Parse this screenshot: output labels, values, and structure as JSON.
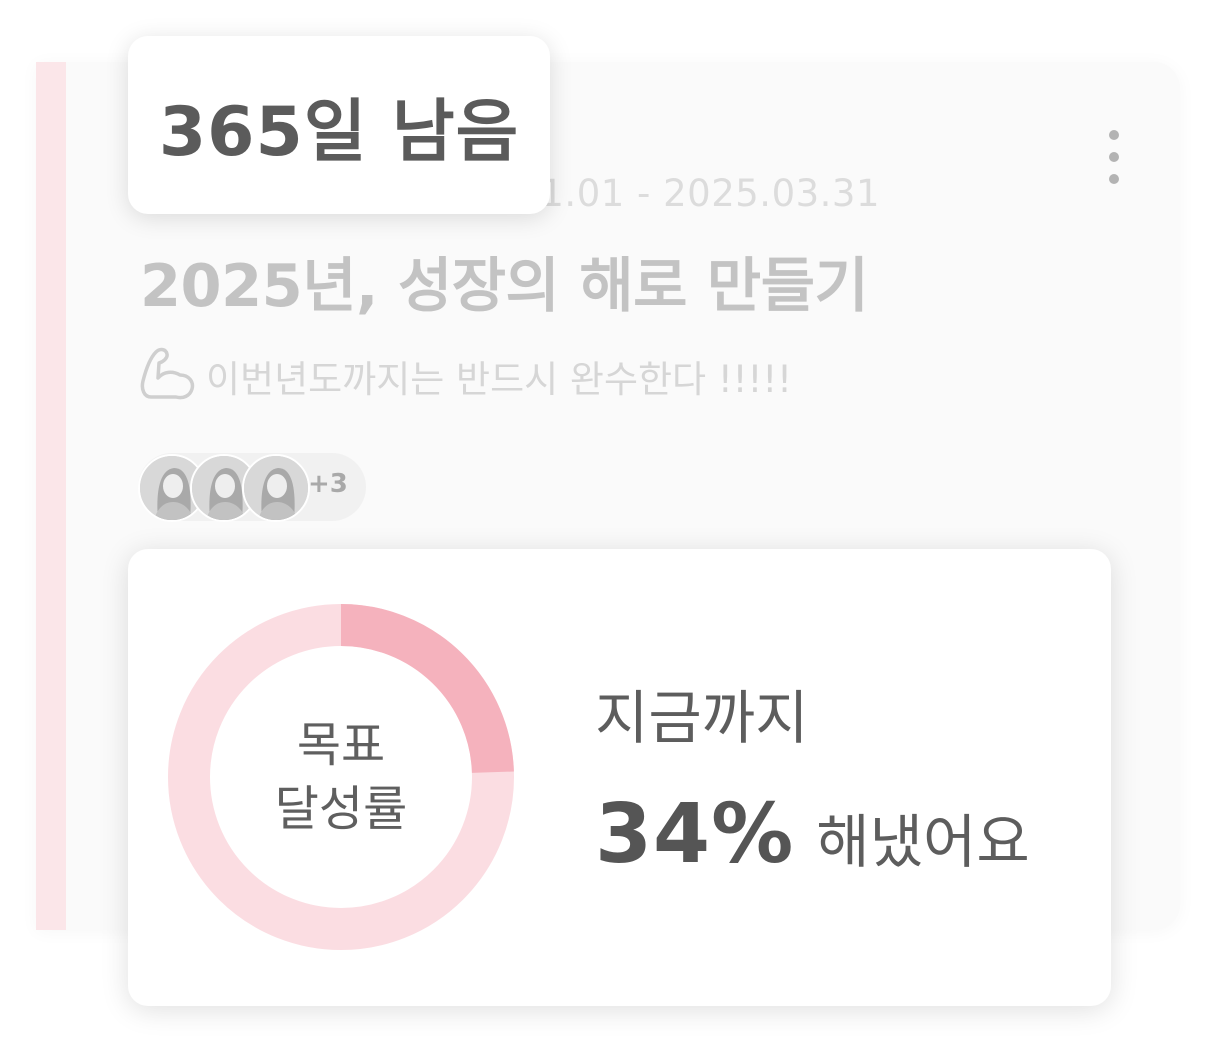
{
  "goal": {
    "period": "2025.01.01 - 2025.03.31",
    "title": "2025년, 성장의 해로 만들기",
    "motto_icon": "flexed-arm-icon",
    "motto": "이번년도까지는 반드시 완수한다 !!!!!",
    "more_icon": "more-vertical-icon"
  },
  "participants": {
    "extra_count": "+3"
  },
  "days_badge": {
    "text": "365일 남음"
  },
  "progress": {
    "label_line1": "목표",
    "label_line2": "달성률",
    "so_far": "지금까지",
    "percent": 34,
    "percent_text": "34%",
    "suffix": "해냈어요"
  },
  "colors": {
    "accent": "#fbe6e9",
    "ring_track": "#fbdde2",
    "ring_fill": "#f5b2bd",
    "text_dark": "#5b5b5b"
  }
}
